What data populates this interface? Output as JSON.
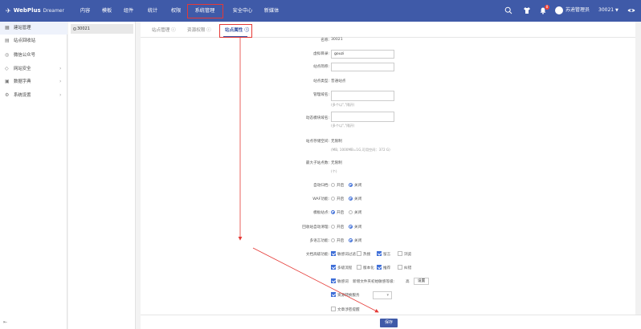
{
  "app": {
    "logo_brand": "WebPlus",
    "logo_sub": "Dreamer"
  },
  "nav": [
    {
      "label": "内容"
    },
    {
      "label": "模板"
    },
    {
      "label": "组件"
    },
    {
      "label": "统计"
    },
    {
      "label": "权限"
    },
    {
      "label": "系统管理"
    },
    {
      "label": "安全中心"
    },
    {
      "label": "新媒体"
    }
  ],
  "header": {
    "notification_count": "8",
    "user_name": "苏迪管理员",
    "site_selector": "30021"
  },
  "sidebar": {
    "items": [
      {
        "label": "建站管理",
        "icon": "grid-icon"
      },
      {
        "label": "站点回收站",
        "icon": "recycle-icon"
      },
      {
        "label": "微信公众号",
        "icon": "wechat-icon"
      },
      {
        "label": "网站安全",
        "icon": "shield-icon"
      },
      {
        "label": "数据字典",
        "icon": "book-icon"
      },
      {
        "label": "系统设置",
        "icon": "settings-icon"
      }
    ]
  },
  "site_panel": {
    "site": "30021"
  },
  "tabs": [
    {
      "label": "站点管理"
    },
    {
      "label": "资源权限"
    },
    {
      "label": "站点属性"
    }
  ],
  "form": {
    "name_label": "名称:",
    "name_value": "30021",
    "vdir_label": "虚拟目录:",
    "vdir_value": "gouzi",
    "abbr_label": "站点简称:",
    "type_label": "站点类型:",
    "type_value": "普通站点",
    "domain_label": "管理域名:",
    "domain_hint": "(多个以\",\"隔开)",
    "dyn_domain_label": "动态模块域名:",
    "dyn_domain_hint": "(多个以\",\"隔开)",
    "storage_label": "站点存储空间:",
    "storage_value": "无限制",
    "storage_hint": "(MB, 1000MB=1G,可用空间：372 G)",
    "max_sub_label": "最大子站点数:",
    "max_sub_value": "无限制",
    "max_sub_hint": "(个)",
    "open": "开启",
    "close": "关闭",
    "auto_archive_label": "自动归档:",
    "waf_label": "WAF功能:",
    "template_site_label": "模板站点:",
    "recycle_clean_label": "回收站自动清理:",
    "multilang_label": "多语言功能:",
    "adv_label": "文档高级功能:",
    "adv_opts": [
      "敏感词过滤",
      "热搜",
      "留言",
      "浏览"
    ],
    "adv_row2": [
      "多级流程",
      "版本化",
      "推荐",
      "纠错"
    ],
    "sensitive_label": "敏感词",
    "sensitive_hint": "新增文件夹初始敏感等级:",
    "sensitive_level": "高",
    "set_button": "设置",
    "resource_label": "资源转换服务",
    "article_label": "文章涉密提醒"
  },
  "footer": {
    "save_label": "保存"
  },
  "colors": {
    "accent": "#3f5aa8",
    "highlight": "#e53935"
  }
}
